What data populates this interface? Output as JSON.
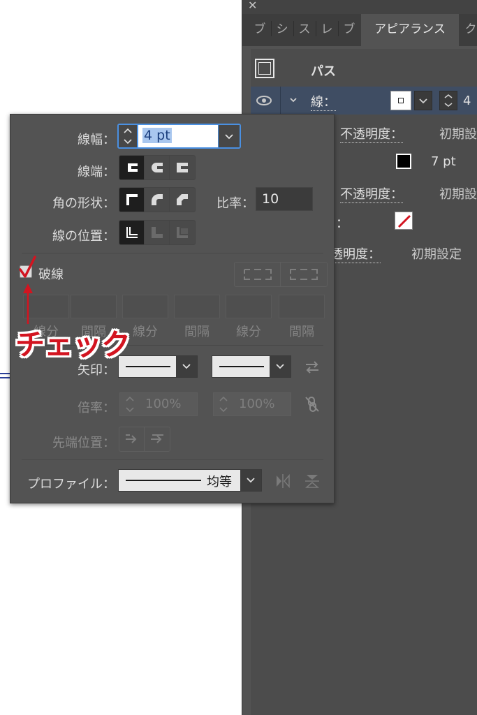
{
  "appearance_panel": {
    "close_glyph": "✕",
    "tabs": [
      "ブ",
      "シ",
      "ス",
      "レ",
      "ブ",
      "アピアランス",
      "ク"
    ],
    "active_tab": "アピアランス",
    "path_label": "パス",
    "stroke_row": {
      "label": "線：",
      "weight_partial": "4"
    },
    "rows": [
      {
        "label": "不透明度：",
        "value": "初期設"
      },
      {
        "label": "",
        "value": "7 pt"
      },
      {
        "label": "不透明度：",
        "value": "初期設"
      },
      {
        "label": "："
      },
      {
        "label": "透明度：",
        "value": "初期設定"
      }
    ]
  },
  "stroke_panel": {
    "weight_label": "線幅：",
    "weight_value": "4 pt",
    "cap_label": "線端：",
    "corner_label": "角の形状：",
    "limit_label": "比率：",
    "limit_value": "10",
    "align_label": "線の位置：",
    "dashed_label": "破線",
    "dashed_checked": true,
    "dash_labels": [
      "線分",
      "間隔",
      "線分",
      "間隔",
      "線分",
      "間隔"
    ],
    "arrow_label": "矢印：",
    "scale_label": "倍率：",
    "scale_values": [
      "100%",
      "100%"
    ],
    "tip_label": "先端位置：",
    "profile_label": "プロファイル：",
    "profile_value": "均等"
  },
  "annotation": {
    "text": "チェック",
    "color": "#d31420"
  },
  "colors": {
    "panel": "#535353",
    "selection": "#3f4d63",
    "annotation": "#d31420",
    "input_focus": "#4a90e2"
  }
}
